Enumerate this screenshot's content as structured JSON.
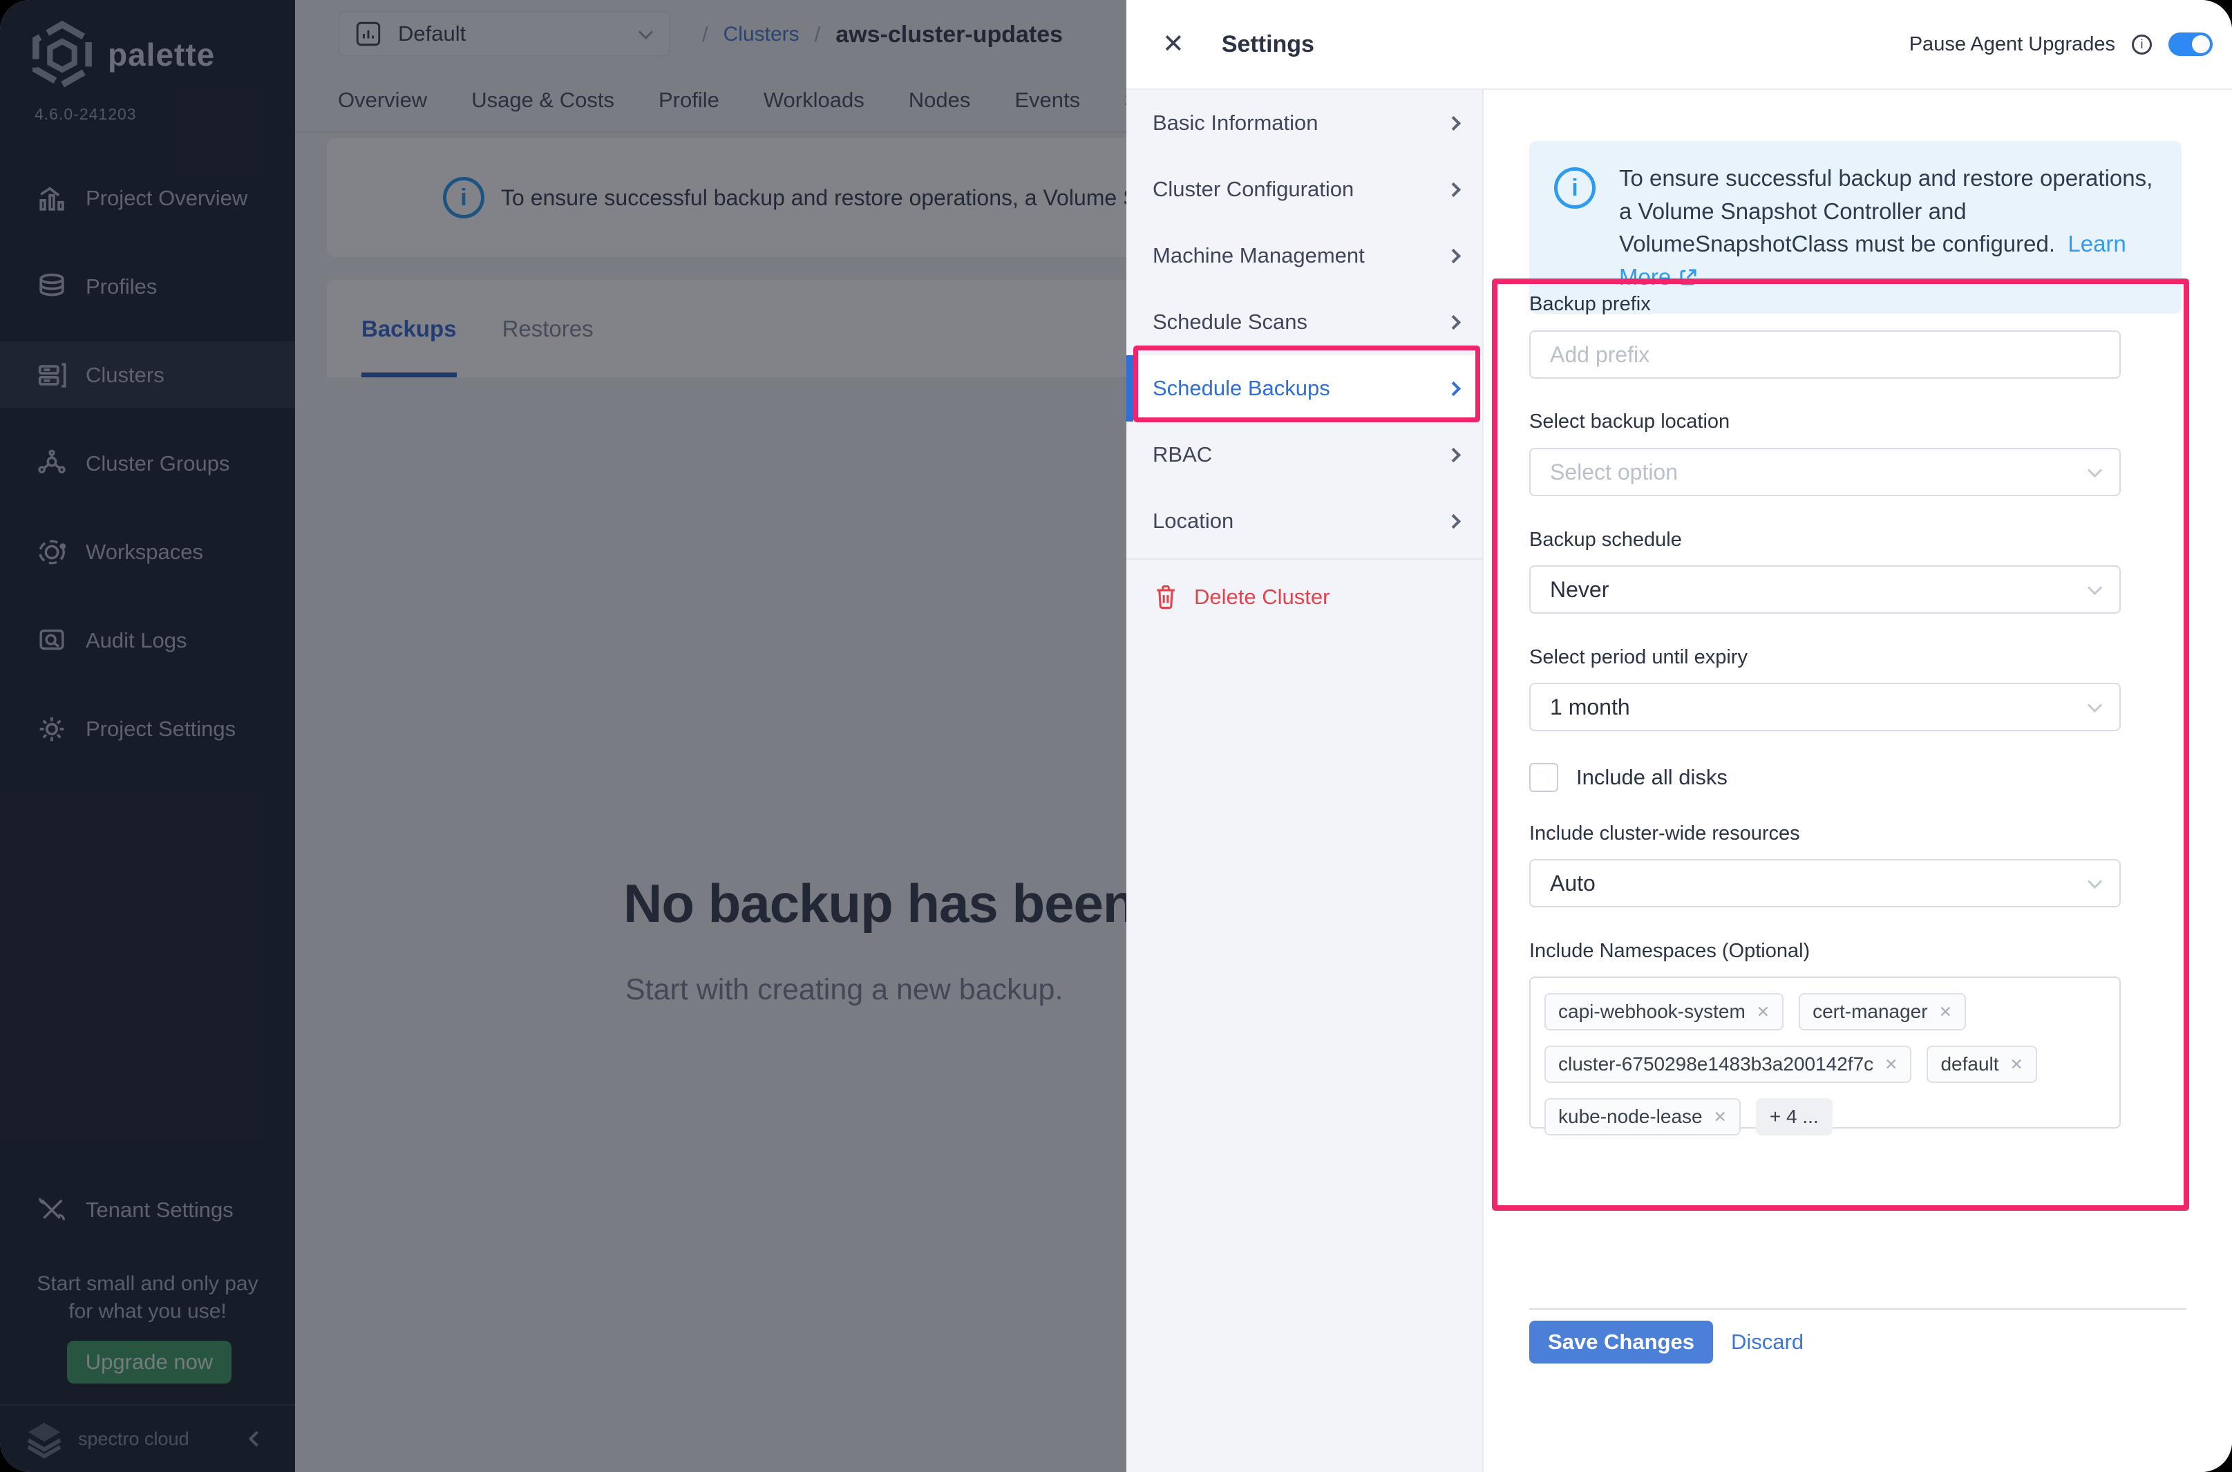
{
  "colors": {
    "annotation-pink": "#f0256b",
    "primary-blue": "#2f6fd9",
    "link-blue": "#2f9bef",
    "toggle-blue": "#2e8af0",
    "save-blue": "#4c80d8",
    "delete-red": "#e2444e",
    "upgrade-green": "#45a06a",
    "sidebar-bg": "#232a38",
    "tab-underline-blue": "#2e62c9"
  },
  "sidebar": {
    "logo_text": "palette",
    "version": "4.6.0-241203",
    "items": [
      {
        "label": "Project Overview",
        "icon": "bar-chart-icon"
      },
      {
        "label": "Profiles",
        "icon": "layers-icon"
      },
      {
        "label": "Clusters",
        "icon": "server-rack-icon"
      },
      {
        "label": "Cluster Groups",
        "icon": "network-nodes-icon"
      },
      {
        "label": "Workspaces",
        "icon": "orbit-icon"
      },
      {
        "label": "Audit Logs",
        "icon": "document-search-icon"
      },
      {
        "label": "Project Settings",
        "icon": "gear-icon"
      }
    ],
    "active_item": "Clusters",
    "tenant_settings_label": "Tenant Settings",
    "promo_line1": "Start small and only pay",
    "promo_line2": "for what you use!",
    "upgrade_button": "Upgrade now",
    "footer_brand": "spectro cloud"
  },
  "header": {
    "project_selector": "Default",
    "breadcrumb": {
      "separator": "/",
      "parent": "Clusters",
      "current": "aws-cluster-updates"
    },
    "tabs": [
      "Overview",
      "Usage & Costs",
      "Profile",
      "Workloads",
      "Nodes",
      "Events",
      "S"
    ]
  },
  "content": {
    "banner_text": "To ensure successful backup and restore operations, a Volume Snapshot C",
    "tabs": {
      "backups": "Backups",
      "restores": "Restores",
      "active": "Backups"
    },
    "empty_title": "No backup has been set up y",
    "empty_subtitle": "Start with creating a new backup."
  },
  "modal": {
    "title": "Settings",
    "close_glyph": "✕",
    "pause_agent": {
      "label": "Pause Agent Upgrades",
      "info_glyph": "i",
      "enabled": true
    },
    "nav": {
      "items": [
        "Basic Information",
        "Cluster Configuration",
        "Machine Management",
        "Schedule Scans",
        "Schedule Backups",
        "RBAC",
        "Location"
      ],
      "active": "Schedule Backups",
      "delete_label": "Delete Cluster"
    },
    "info_box": {
      "glyph": "i",
      "text": "To ensure successful backup and restore operations, a Volume Snapshot Controller and VolumeSnapshotClass must be configured.",
      "link_label": "Learn More"
    },
    "form": {
      "backup_prefix": {
        "label": "Backup prefix",
        "placeholder": "Add prefix",
        "value": ""
      },
      "backup_location": {
        "label": "Select backup location",
        "placeholder": "Select option",
        "value": ""
      },
      "backup_schedule": {
        "label": "Backup schedule",
        "value": "Never"
      },
      "expiry_period": {
        "label": "Select period until expiry",
        "value": "1 month"
      },
      "include_all_disks": {
        "label": "Include all disks",
        "checked": false
      },
      "cluster_wide_resources": {
        "label": "Include cluster-wide resources",
        "value": "Auto"
      },
      "namespaces": {
        "label": "Include Namespaces (Optional)",
        "remove_glyph": "✕",
        "tags": [
          "capi-webhook-system",
          "cert-manager",
          "cluster-6750298e1483b3a200142f7c",
          "default",
          "kube-node-lease"
        ],
        "more_label": "+ 4 ..."
      }
    },
    "actions": {
      "save": "Save Changes",
      "discard": "Discard"
    }
  }
}
